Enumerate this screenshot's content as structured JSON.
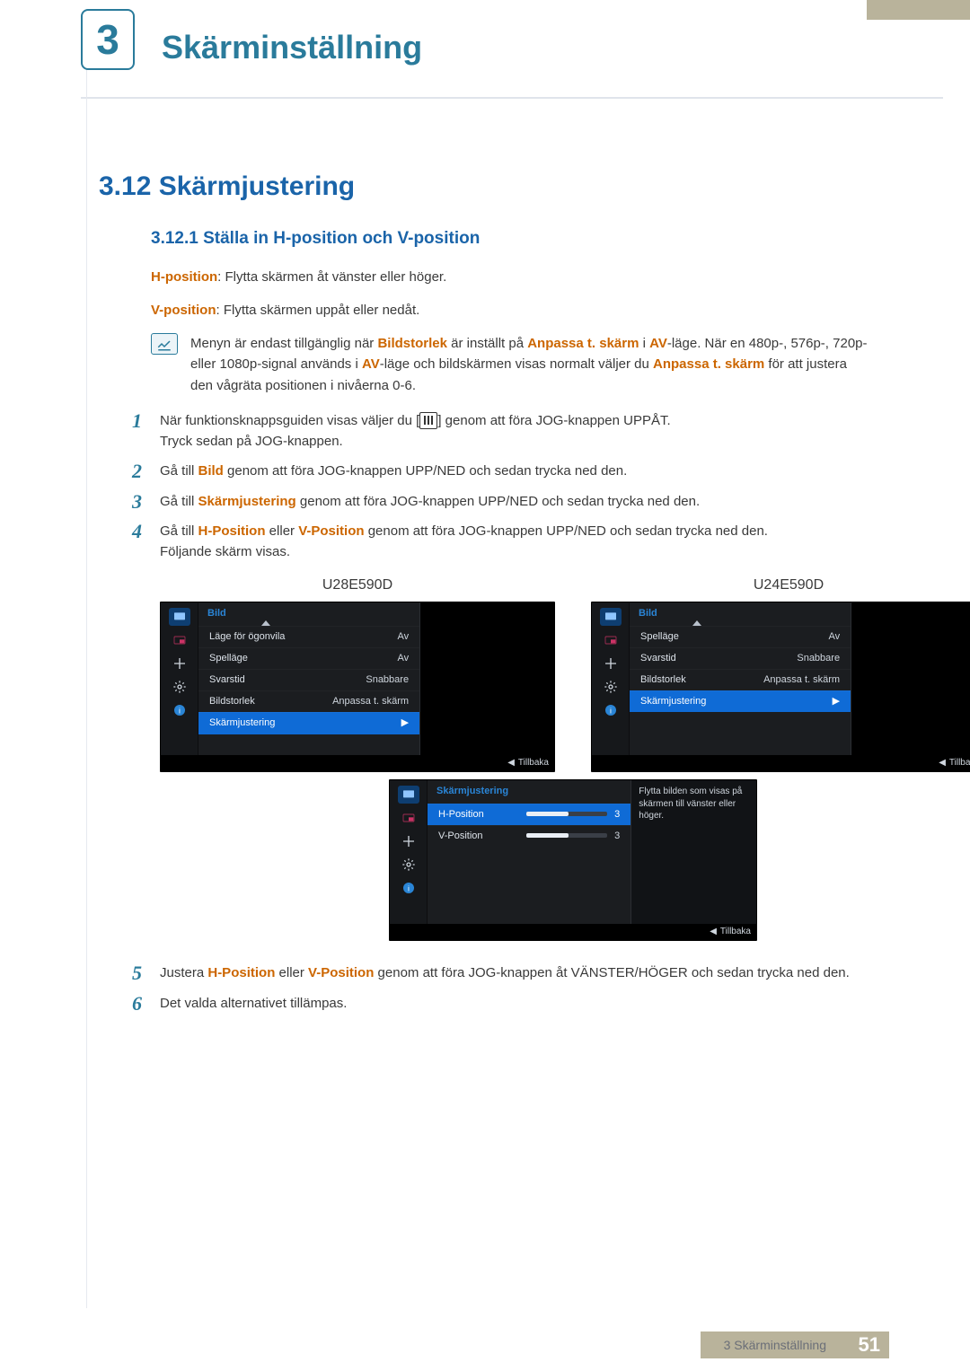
{
  "chapter": {
    "number": "3",
    "title": "Skärminställning"
  },
  "h2": "3.12 Skärmjustering",
  "h3": "3.12.1 Ställa in H-position och V-position",
  "defs": {
    "hpos_label": "H-position",
    "hpos_text": ": Flytta skärmen åt vänster eller höger.",
    "vpos_label": "V-position",
    "vpos_text": ": Flytta skärmen uppåt eller nedåt."
  },
  "note": {
    "pre": "Menyn är endast tillgänglig när ",
    "bildstorlek": "Bildstorlek",
    "mid1": " är inställt på ",
    "anpassa": "Anpassa t. skärm",
    "mid2": " i ",
    "av": "AV",
    "mid3": "-läge. När en 480p-, 576p-, 720p- eller 1080p-signal används i ",
    "mid4": "-läge och bildskärmen visas normalt väljer du ",
    "anpassa2": "Anpassa t. skärm",
    "post": " för att justera den vågräta positionen i nivåerna 0-6."
  },
  "steps": {
    "s1a": "När funktionsknappsguiden visas väljer du [",
    "s1b": "] genom att föra JOG-knappen UPPÅT.",
    "s1c": "Tryck sedan på JOG-knappen.",
    "s2a": "Gå till ",
    "s2b": "Bild",
    "s2c": " genom att föra JOG-knappen UPP/NED och sedan trycka ned den.",
    "s3a": "Gå till ",
    "s3b": "Skärmjustering",
    "s3c": " genom att föra JOG-knappen UPP/NED och sedan trycka ned den.",
    "s4a": "Gå till ",
    "s4b": "H-Position",
    "s4c": " eller ",
    "s4d": "V-Position",
    "s4e": " genom att föra JOG-knappen UPP/NED och sedan trycka ned den.",
    "s4f": "Följande skärm visas.",
    "s5a": "Justera ",
    "s5b": "H-Position",
    "s5c": " eller ",
    "s5d": "V-Position",
    "s5e": " genom att föra JOG-knappen åt VÄNSTER/HÖGER och sedan trycka ned den.",
    "s6": "Det valda alternativet tillämpas."
  },
  "osd": {
    "back": "Tillbaka",
    "u28": {
      "caption": "U28E590D",
      "header": "Bild",
      "rows": [
        {
          "lbl": "Läge för ögonvila",
          "val": "Av"
        },
        {
          "lbl": "Spelläge",
          "val": "Av"
        },
        {
          "lbl": "Svarstid",
          "val": "Snabbare"
        },
        {
          "lbl": "Bildstorlek",
          "val": "Anpassa t. skärm"
        },
        {
          "lbl": "Skärmjustering",
          "val": "▶",
          "sel": true
        }
      ]
    },
    "u24": {
      "caption": "U24E590D",
      "header": "Bild",
      "rows": [
        {
          "lbl": "Spelläge",
          "val": "Av"
        },
        {
          "lbl": "Svarstid",
          "val": "Snabbare"
        },
        {
          "lbl": "Bildstorlek",
          "val": "Anpassa t. skärm"
        },
        {
          "lbl": "Skärmjustering",
          "val": "▶",
          "sel": true
        }
      ]
    },
    "detail": {
      "header": "Skärmjustering",
      "rows": [
        {
          "lbl": "H-Position",
          "val": "3",
          "sel": true,
          "bar": true
        },
        {
          "lbl": "V-Position",
          "val": "3",
          "bar": true
        }
      ],
      "desc": "Flytta bilden som visas på skärmen till vänster eller höger."
    }
  },
  "footer": {
    "text": "3 Skärminställning",
    "page": "51"
  },
  "nums": {
    "1": "1",
    "2": "2",
    "3": "3",
    "4": "4",
    "5": "5",
    "6": "6"
  }
}
